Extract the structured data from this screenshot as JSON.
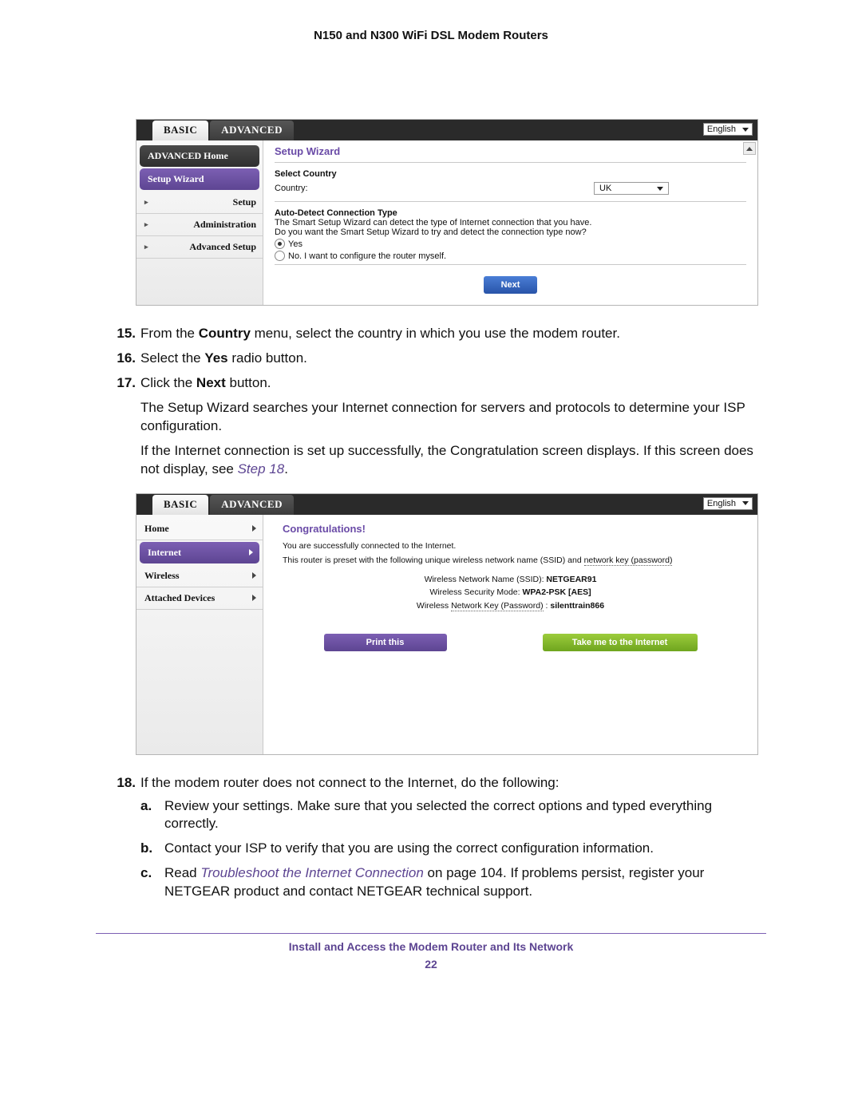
{
  "doc": {
    "title": "N150 and N300 WiFi DSL Modem Routers",
    "footer": "Install and Access the Modem Router and Its Network",
    "page_number": "22"
  },
  "screenshot1": {
    "tabs": {
      "basic": "BASIC",
      "advanced": "ADVANCED"
    },
    "language": "English",
    "sidebar": {
      "advanced_home": "ADVANCED Home",
      "setup_wizard": "Setup Wizard",
      "setup": "Setup",
      "administration": "Administration",
      "advanced_setup": "Advanced Setup"
    },
    "pane": {
      "title": "Setup Wizard",
      "select_country_heading": "Select Country",
      "country_label": "Country:",
      "country_value": "UK",
      "autodetect_heading": "Auto-Detect Connection Type",
      "autodetect_line1": "The Smart Setup Wizard can detect the type of Internet connection that you have.",
      "autodetect_line2": "Do you want the Smart Setup Wizard to try and detect the connection type now?",
      "radio_yes": "Yes",
      "radio_no": "No. I want to configure the router myself.",
      "next_button": "Next"
    }
  },
  "screenshot2": {
    "tabs": {
      "basic": "BASIC",
      "advanced": "ADVANCED"
    },
    "language": "English",
    "sidebar": {
      "home": "Home",
      "internet": "Internet",
      "wireless": "Wireless",
      "attached_devices": "Attached Devices"
    },
    "pane": {
      "title": "Congratulations!",
      "line1": "You are successfully connected to the Internet.",
      "line2_a": "This router is preset with the following unique wireless network name (SSID) and ",
      "line2_b": "network key (password)",
      "ssid_label": "Wireless Network Name (SSID): ",
      "ssid_value": "NETGEAR91",
      "mode_label": "Wireless Security Mode: ",
      "mode_value": "WPA2-PSK [AES]",
      "key_label_a": "Wireless ",
      "key_label_b": "Network Key (Password)",
      "key_label_c": " : ",
      "key_value": "silenttrain866",
      "print_button": "Print this",
      "take_button": "Take me to the Internet"
    }
  },
  "instructions": {
    "step15_a": "From the ",
    "step15_b": "Country",
    "step15_c": " menu, select the country in which you use the modem router.",
    "step16_a": "Select the ",
    "step16_b": "Yes",
    "step16_c": " radio button.",
    "step17_a": "Click the ",
    "step17_b": "Next",
    "step17_c": " button.",
    "step17_p1": "The Setup Wizard searches your Internet connection for servers and protocols to determine your ISP configuration.",
    "step17_p2a": "If the Internet connection is set up successfully, the Congratulation screen displays. If this screen does not display, see ",
    "step17_p2b": "Step 18",
    "step17_p2c": ".",
    "step18": "If the modem router does not connect to the Internet, do the following:",
    "step18a": "Review your settings. Make sure that you selected the correct options and typed everything correctly.",
    "step18b": "Contact your ISP to verify that you are using the correct configuration information.",
    "step18c_a": "Read ",
    "step18c_link": "Troubleshoot the Internet Connection",
    "step18c_b": " on page 104. If problems persist, register your NETGEAR product and contact NETGEAR technical support."
  }
}
